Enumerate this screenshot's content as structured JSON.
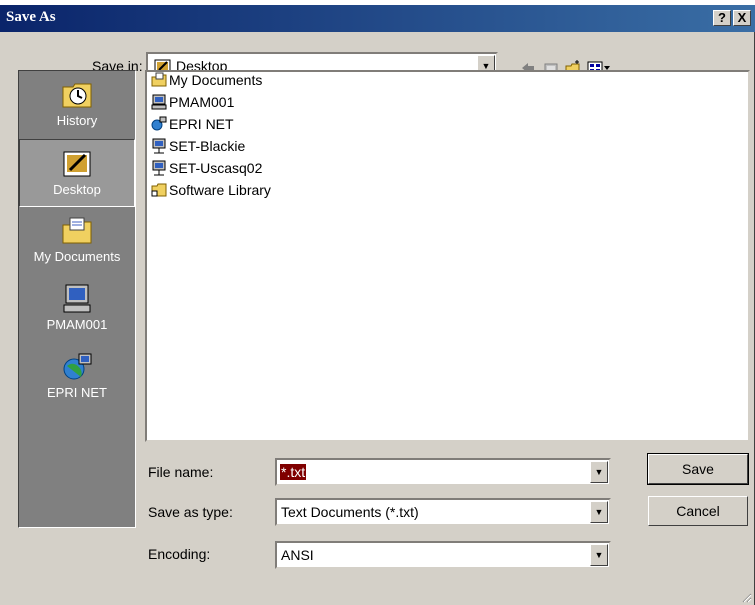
{
  "window": {
    "title": "Save As",
    "help_label": "?",
    "close_label": "X"
  },
  "save_in": {
    "label": "Save in:",
    "value": "Desktop"
  },
  "places": [
    {
      "label": "History"
    },
    {
      "label": "Desktop"
    },
    {
      "label": "My Documents"
    },
    {
      "label": "PMAM001"
    },
    {
      "label": "EPRI NET"
    }
  ],
  "files": [
    {
      "name": "My Documents"
    },
    {
      "name": "PMAM001"
    },
    {
      "name": "EPRI NET"
    },
    {
      "name": "SET-Blackie"
    },
    {
      "name": "SET-Uscasq02"
    },
    {
      "name": "Software Library"
    }
  ],
  "form": {
    "file_name_label": "File name:",
    "file_name_value": "*.txt",
    "save_as_type_label": "Save as type:",
    "save_as_type_value": "Text Documents (*.txt)",
    "encoding_label": "Encoding:",
    "encoding_value": "ANSI"
  },
  "buttons": {
    "save": "Save",
    "cancel": "Cancel"
  },
  "colors": {
    "titlebar": "#0a246a",
    "face": "#d4d0c8",
    "places_bg": "#808080",
    "selection": "#800000"
  }
}
